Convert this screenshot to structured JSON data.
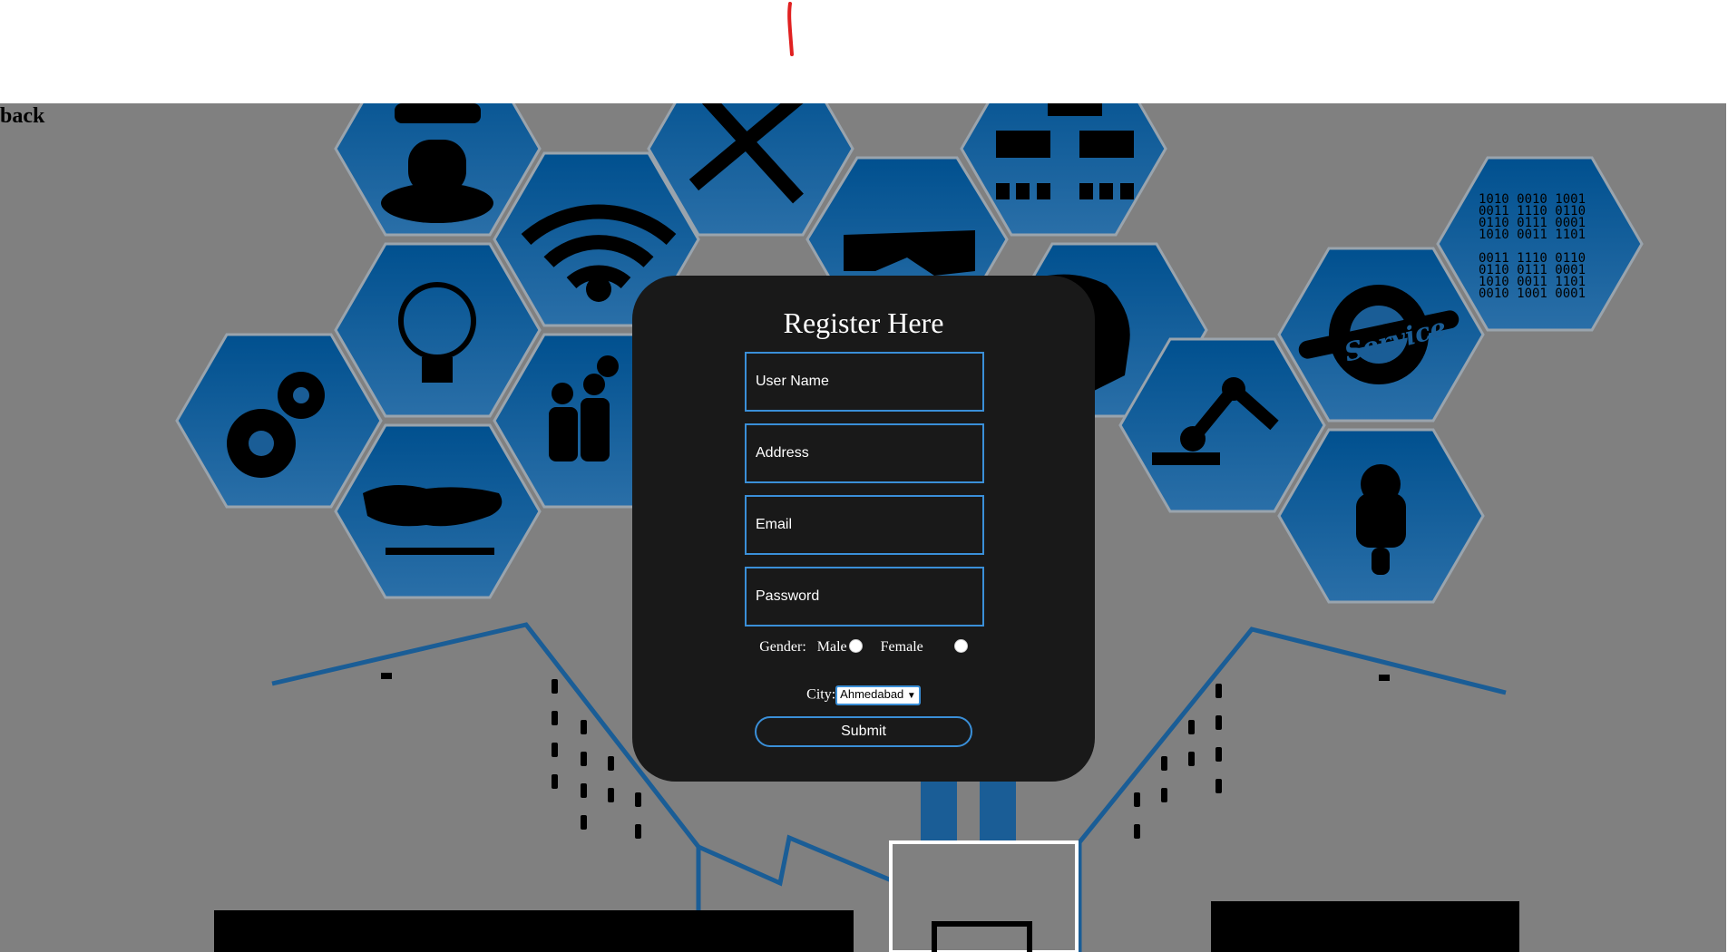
{
  "nav": {
    "back_label": "back"
  },
  "form": {
    "title": "Register Here",
    "username_placeholder": "User Name",
    "address_placeholder": "Address",
    "email_placeholder": "Email",
    "password_placeholder": "Password",
    "gender_label": "Gender:",
    "male_label": "Male",
    "female_label": "Female",
    "city_label": "City:",
    "city_selected": "Ahmedabad",
    "submit_label": "Submit"
  },
  "background": {
    "binary_lines": [
      "1010 0010 1001",
      "0011 1110 0110",
      "0110 0111 0001",
      "1010 0011 1101",
      "",
      "0011 1110 0110",
      "0110 0111 0001",
      "1010 0011 1101",
      "0010 1001 0001"
    ],
    "service_badge_text": "Service"
  },
  "colors": {
    "page_bg": "#808080",
    "card_bg": "#191919",
    "accent_blue": "#3a8fd8",
    "hex_blue": "#0d5c9c",
    "red_mark": "#e02020"
  }
}
